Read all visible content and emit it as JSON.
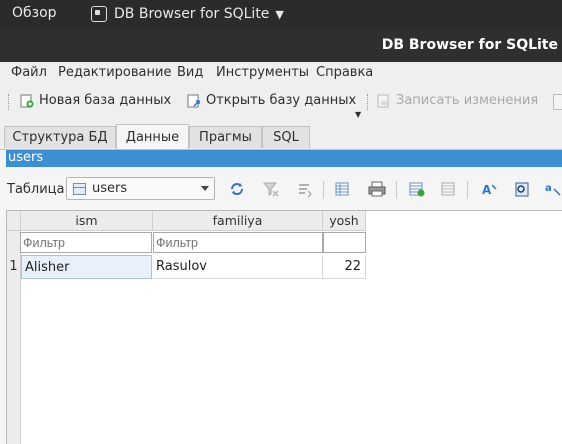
{
  "topbar": {
    "activities": "Обзор",
    "app_name": "DB Browser for SQLite"
  },
  "window": {
    "title": "DB Browser for SQLite"
  },
  "menu": [
    "Файл",
    "Редактирование",
    "Вид",
    "Инструменты",
    "Справка"
  ],
  "toolbar": {
    "new_db": "Новая база данных",
    "open_db": "Открыть базу данных",
    "write_changes": "Записать изменения"
  },
  "tabs": [
    "Структура БД",
    "Данные",
    "Прагмы",
    "SQL"
  ],
  "active_tab": "Данные",
  "browse": {
    "current_table_banner": "users",
    "table_label": "Таблица:",
    "table_selected": "users"
  },
  "grid": {
    "columns": [
      "ism",
      "familiya",
      "yosh"
    ],
    "filter_placeholder": "Фильтр",
    "rows": [
      {
        "num": "1",
        "ism": "Alisher",
        "familiya": "Rasulov",
        "yosh": "22"
      }
    ]
  },
  "colors": {
    "accent": "#3d8fd1",
    "topbar": "#2b2b2b",
    "titlebar": "#2f2f2f"
  }
}
